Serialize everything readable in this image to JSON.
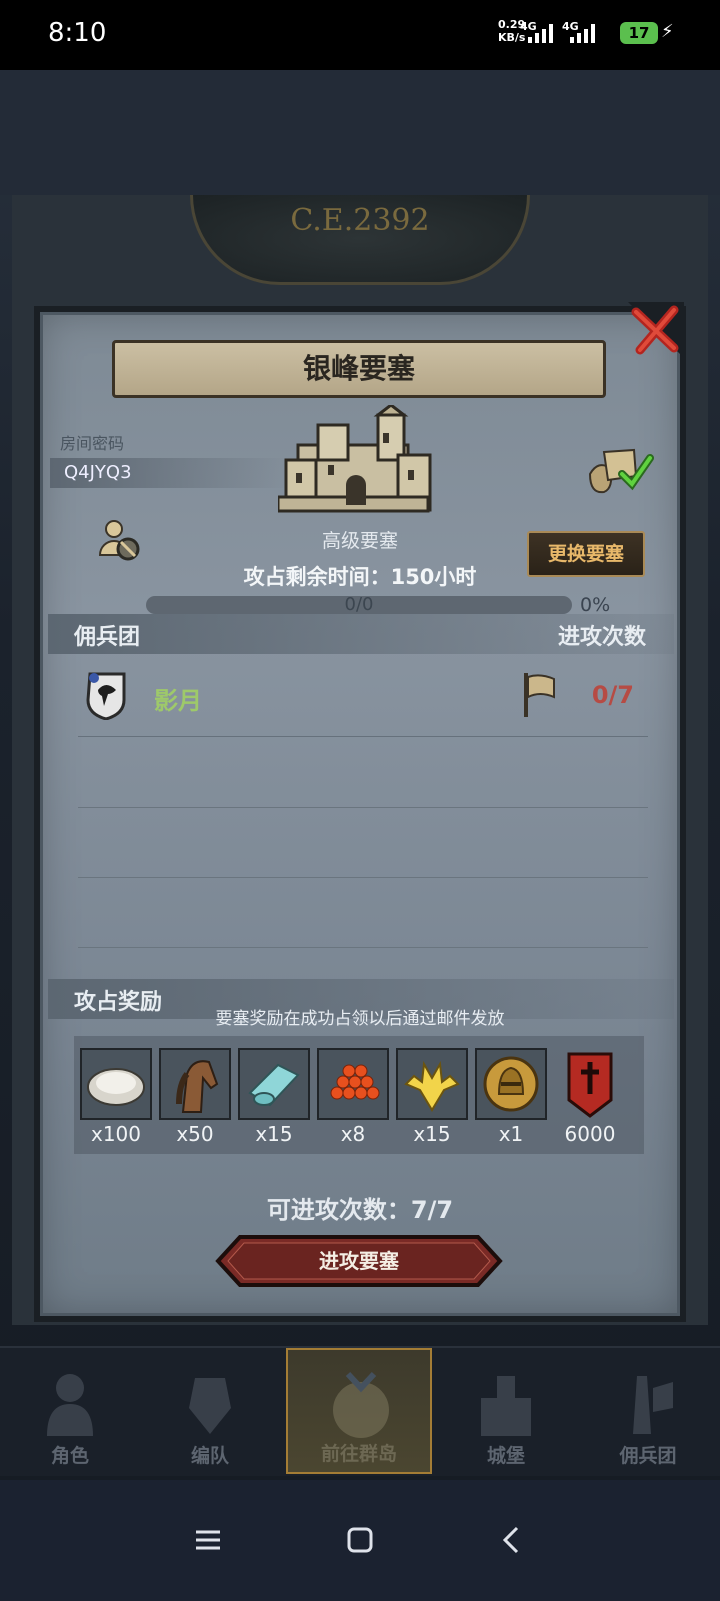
{
  "status_bar": {
    "time": "8:10",
    "net_speed": "0.29",
    "net_unit": "KB/s",
    "sim1": "4G",
    "sim2": "4G",
    "battery": "17"
  },
  "scene": {
    "era": "C.E.2392"
  },
  "dialog": {
    "title": "银峰要塞",
    "room_password_label": "房间密码",
    "room_password": "Q4JYQ3",
    "fortress_level": "高级要塞",
    "change_button": "更换要塞",
    "timer_label": "攻占剩余时间：150小时",
    "progress": {
      "text": "0/0",
      "percent_text": "0%",
      "value": 0
    },
    "mercenary_section": {
      "left": "佣兵团",
      "right": "进攻次数"
    },
    "guilds": [
      {
        "name": "影月",
        "attacks": "0/7"
      }
    ],
    "reward_section": {
      "title": "攻占奖励",
      "note": "要塞奖励在成功占领以后通过邮件发放"
    },
    "rewards": [
      {
        "icon": "oyster-icon",
        "qty": "x100"
      },
      {
        "icon": "horse-icon",
        "qty": "x50"
      },
      {
        "icon": "cloth-icon",
        "qty": "x15"
      },
      {
        "icon": "roe-icon",
        "qty": "x8"
      },
      {
        "icon": "golden-crest-icon",
        "qty": "x15"
      },
      {
        "icon": "knight-helmet-icon",
        "qty": "x1"
      },
      {
        "icon": "banner-icon",
        "qty": "6000"
      }
    ],
    "remaining_attacks": "可进攻次数：7/7",
    "attack_button": "进攻要塞"
  },
  "nav": {
    "items": [
      {
        "label": "角色",
        "active": false
      },
      {
        "label": "编队",
        "active": false
      },
      {
        "label": "前往群岛",
        "active": true
      },
      {
        "label": "城堡",
        "active": false
      },
      {
        "label": "佣兵团",
        "active": false
      }
    ]
  },
  "colors": {
    "guild_name": "#9ec96a",
    "attacks_count": "#b64b44",
    "change_button_text": "#e8b86a"
  }
}
